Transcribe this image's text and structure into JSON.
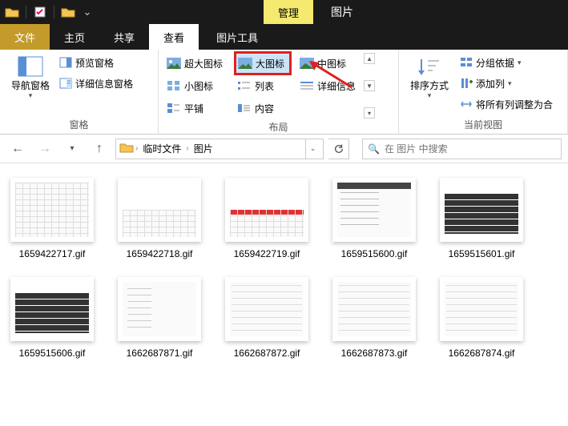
{
  "titlebar": {
    "context_tab": "管理",
    "window_title": "图片"
  },
  "tabs": {
    "file": "文件",
    "home": "主页",
    "share": "共享",
    "view": "查看",
    "picture_tools": "图片工具"
  },
  "ribbon": {
    "panes": {
      "nav_pane": "导航窗格",
      "preview_pane": "预览窗格",
      "details_pane": "详细信息窗格",
      "group_label": "窗格"
    },
    "layout": {
      "extra_large": "超大图标",
      "large": "大图标",
      "medium": "中图标",
      "small": "小图标",
      "list": "列表",
      "details": "详细信息",
      "tiles": "平铺",
      "content": "内容",
      "group_label": "布局"
    },
    "current_view": {
      "sort_by": "排序方式",
      "group_by": "分组依据",
      "add_columns": "添加列",
      "size_columns": "将所有列调整为合",
      "group_label": "当前视图"
    }
  },
  "nav": {
    "breadcrumb": [
      "临时文件",
      "图片"
    ],
    "search_placeholder": "在 图片 中搜索"
  },
  "files": [
    {
      "name": "1659422717.gif",
      "style": "grid"
    },
    {
      "name": "1659422718.gif",
      "style": "grid-half"
    },
    {
      "name": "1659422719.gif",
      "style": "grid-red"
    },
    {
      "name": "1659515600.gif",
      "style": "dark-header"
    },
    {
      "name": "1659515601.gif",
      "style": "dark"
    },
    {
      "name": "1659515606.gif",
      "style": "dark"
    },
    {
      "name": "1662687871.gif",
      "style": "sparse"
    },
    {
      "name": "1662687872.gif",
      "style": "lines"
    },
    {
      "name": "1662687873.gif",
      "style": "lines"
    },
    {
      "name": "1662687874.gif",
      "style": "lines"
    }
  ]
}
